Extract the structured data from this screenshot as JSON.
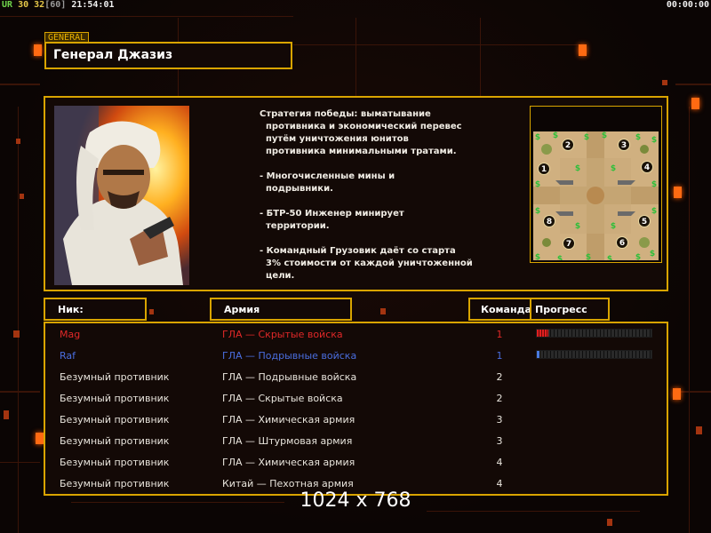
{
  "hud": {
    "label_ur": "UR",
    "fps": "30",
    "fps_alt": "32",
    "fps_cap": "[60]",
    "clock": "21:54:01",
    "timer": "00:00:00"
  },
  "general": {
    "tag": "GENERAL",
    "name": "Генерал Джазиз"
  },
  "strategy": {
    "lines": [
      "Стратегия победы: выматывание",
      "противника и экономический перевес",
      "путём уничтожения юнитов",
      "противника минимальными тратами."
    ],
    "bullet1": [
      "- Многочисленные мины и",
      "подрывники."
    ],
    "bullet2": [
      "- БТР-50 Инженер минирует",
      "территории."
    ],
    "bullet3": [
      "- Командный Грузовик даёт со старта",
      "3% стоимости от каждой уничтоженной",
      "цели."
    ]
  },
  "map": {
    "start_positions": [
      "1",
      "2",
      "3",
      "4",
      "5",
      "6",
      "7",
      "8"
    ]
  },
  "table": {
    "header_nick": "Ник:",
    "header_army": "Армия",
    "header_team": "Команда",
    "header_progress": "Прогресс",
    "rows": [
      {
        "nick": "Mag",
        "army": "ГЛА — Скрытые войска",
        "team": "1",
        "color": "#e02828",
        "progress": 0.1
      },
      {
        "nick": "Raf",
        "army": "ГЛА — Подрывные войска",
        "team": "1",
        "color": "#4a6ee0",
        "progress": 0.02
      },
      {
        "nick": "Безумный противник",
        "army": "ГЛА — Подрывные войска",
        "team": "2",
        "color": "#e8e4dc"
      },
      {
        "nick": "Безумный противник",
        "army": "ГЛА — Скрытые войска",
        "team": "2",
        "color": "#e8e4dc"
      },
      {
        "nick": "Безумный противник",
        "army": "ГЛА — Химическая армия",
        "team": "3",
        "color": "#e8e4dc"
      },
      {
        "nick": "Безумный противник",
        "army": "ГЛА — Штурмовая армия",
        "team": "3",
        "color": "#e8e4dc"
      },
      {
        "nick": "Безумный противник",
        "army": "ГЛА — Химическая армия",
        "team": "4",
        "color": "#e8e4dc"
      },
      {
        "nick": "Безумный противник",
        "army": "Китай — Пехотная армия",
        "team": "4",
        "color": "#e8e4dc"
      }
    ]
  },
  "resolution_label": "1024 x 768"
}
